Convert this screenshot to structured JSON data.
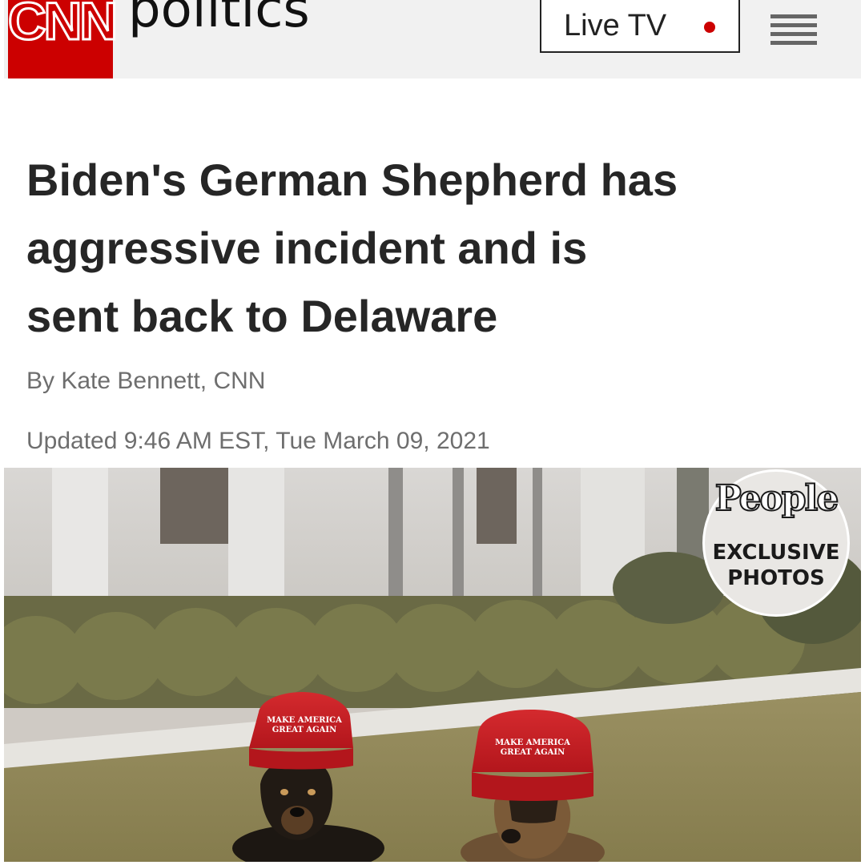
{
  "header": {
    "logo": "CNN",
    "section": "politics",
    "live_tv_label": "Live TV",
    "menu_icon": "hamburger-menu-icon"
  },
  "article": {
    "headline_lines": [
      "Biden's German Shepherd has",
      "aggressive incident and is",
      "sent back to Delaware"
    ],
    "byline": "By Kate Bennett, CNN",
    "timestamp": "Updated 9:46 AM EST, Tue March 09, 2021"
  },
  "photo": {
    "badge_logo": "People",
    "badge_line1": "EXCLUSIVE",
    "badge_line2": "PHOTOS",
    "hat_left_line1": "MAKE AMERICA",
    "hat_left_line2": "GREAT AGAIN",
    "hat_right_line1": "MAKE AMERICA",
    "hat_right_line2": "GREAT AGAIN"
  },
  "colors": {
    "cnn_red": "#cc0000",
    "header_bg": "#f1f1f1",
    "headline": "#262626",
    "meta_text": "#6e6e6e"
  }
}
